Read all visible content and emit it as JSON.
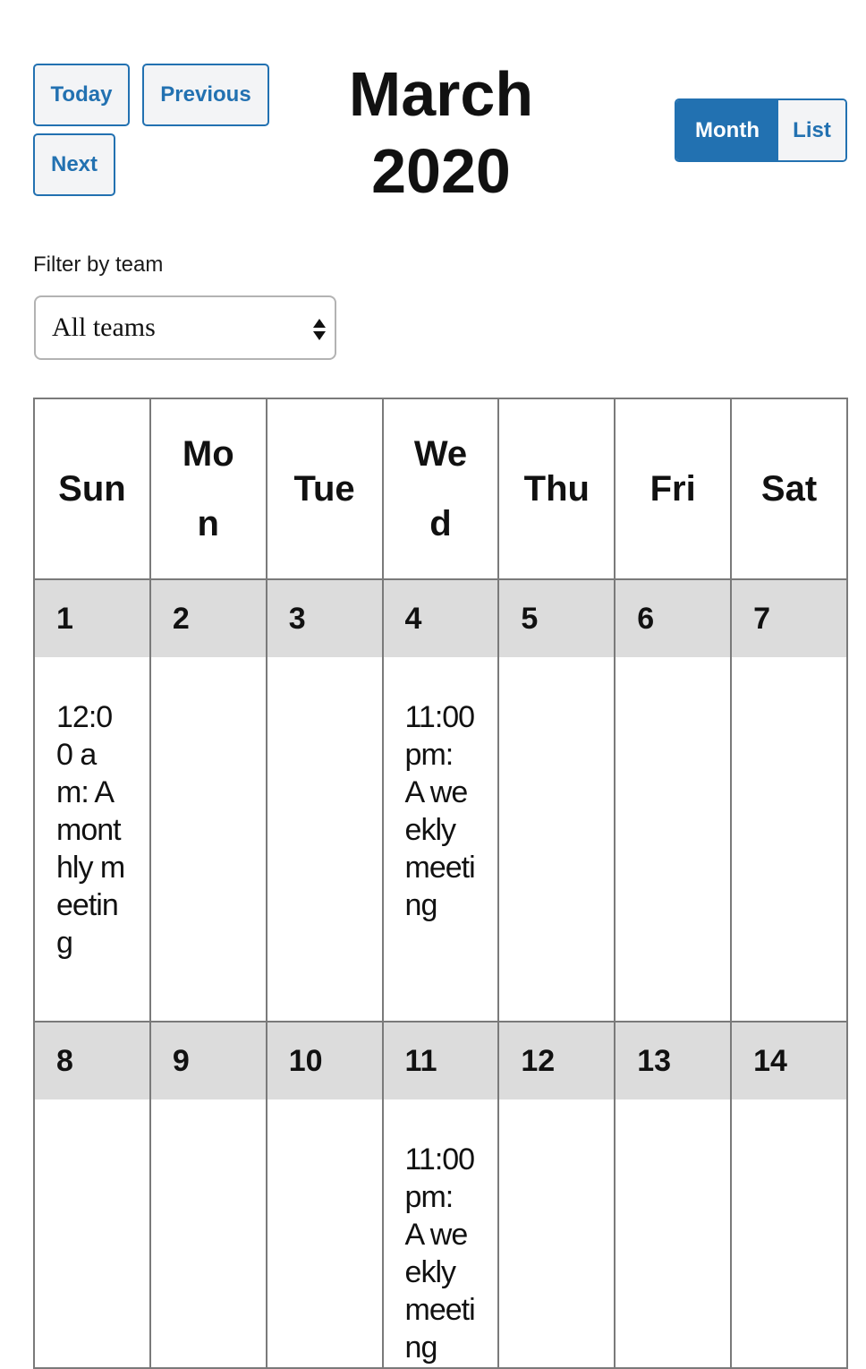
{
  "toolbar": {
    "today_label": "Today",
    "previous_label": "Previous",
    "next_label": "Next",
    "title": "March 2020",
    "view_options": [
      {
        "label": "Month",
        "active": true
      },
      {
        "label": "List",
        "active": false
      }
    ]
  },
  "filter": {
    "label": "Filter by team",
    "selected": "All teams"
  },
  "calendar": {
    "weekdays": [
      "Sun",
      "Mon",
      "Tue",
      "Wed",
      "Thu",
      "Fri",
      "Sat"
    ],
    "weeks": [
      {
        "dates": [
          "1",
          "2",
          "3",
          "4",
          "5",
          "6",
          "7"
        ],
        "events": [
          "12:00 am: A monthly meeting",
          "",
          "",
          "11:00 pm: A weekly meeting",
          "",
          "",
          ""
        ]
      },
      {
        "dates": [
          "8",
          "9",
          "10",
          "11",
          "12",
          "13",
          "14"
        ],
        "events": [
          "",
          "",
          "",
          "11:00 pm: A weekly meeting",
          "",
          "",
          ""
        ]
      }
    ]
  },
  "colors": {
    "accent": "#2271b1",
    "button_bg": "#f3f4f6",
    "date_row_bg": "#dcdcdc",
    "grid_border": "#7a7a7a"
  }
}
